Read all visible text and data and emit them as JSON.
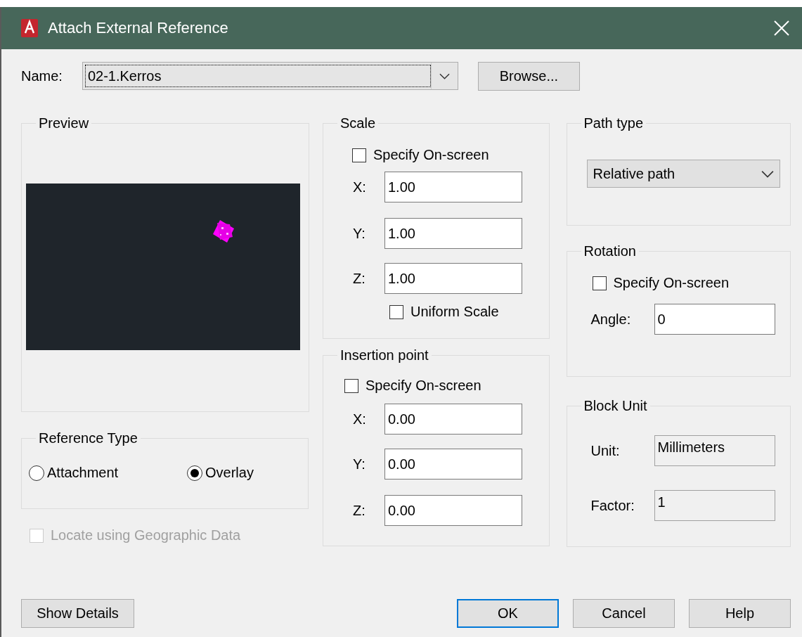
{
  "window": {
    "title": "Attach External Reference"
  },
  "name_field": {
    "label": "Name:",
    "value": "02-1.Kerros"
  },
  "browse_button": {
    "label": "Browse..."
  },
  "preview": {
    "title": "Preview"
  },
  "reference_type": {
    "title": "Reference Type",
    "options": [
      {
        "label": "Attachment",
        "selected": false
      },
      {
        "label": "Overlay",
        "selected": true
      }
    ]
  },
  "locate_geographic": {
    "label": "Locate using Geographic Data",
    "checked": false,
    "disabled": true
  },
  "scale": {
    "title": "Scale",
    "specify_on_screen": {
      "label": "Specify On-screen",
      "checked": false
    },
    "fields": [
      {
        "label": "X:",
        "value": "1.00"
      },
      {
        "label": "Y:",
        "value": "1.00"
      },
      {
        "label": "Z:",
        "value": "1.00"
      }
    ],
    "uniform_scale": {
      "label": "Uniform Scale",
      "checked": false
    }
  },
  "insertion_point": {
    "title": "Insertion point",
    "specify_on_screen": {
      "label": "Specify On-screen",
      "checked": false
    },
    "fields": [
      {
        "label": "X:",
        "value": "0.00"
      },
      {
        "label": "Y:",
        "value": "0.00"
      },
      {
        "label": "Z:",
        "value": "0.00"
      }
    ]
  },
  "path_type": {
    "title": "Path type",
    "value": "Relative path"
  },
  "rotation": {
    "title": "Rotation",
    "specify_on_screen": {
      "label": "Specify On-screen",
      "checked": false
    },
    "angle": {
      "label": "Angle:",
      "value": "0"
    }
  },
  "block_unit": {
    "title": "Block Unit",
    "fields": [
      {
        "label": "Unit:",
        "value": "Millimeters"
      },
      {
        "label": "Factor:",
        "value": "1"
      }
    ]
  },
  "show_details_button": {
    "label": "Show Details"
  },
  "buttons": [
    {
      "label": "OK",
      "default": true
    },
    {
      "label": "Cancel",
      "default": false
    },
    {
      "label": "Help",
      "default": false
    }
  ]
}
